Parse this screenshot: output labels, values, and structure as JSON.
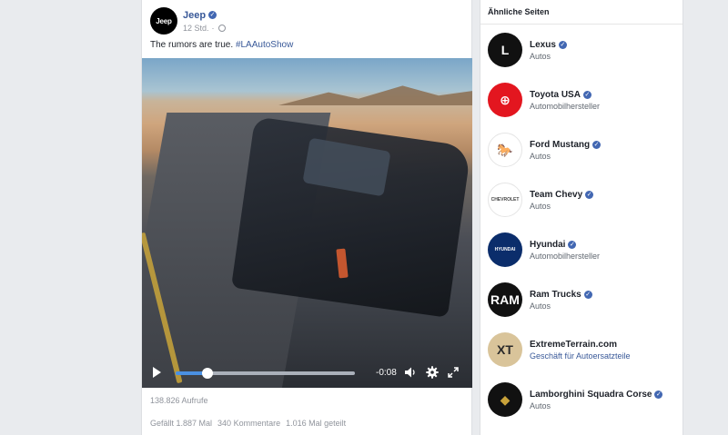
{
  "post": {
    "page_name": "Jeep",
    "avatar_text": "Jeep",
    "verified_mark": "✓",
    "time": "12 Std.",
    "separator": "·",
    "text": "The rumors are true.",
    "hashtag": "#LAAutoShow",
    "video": {
      "time_remaining": "-0:08",
      "progress": 0.18
    },
    "views": "138.826 Aufrufe",
    "likes": "Gefällt 1.887 Mal",
    "comments": "340 Kommentare",
    "shares": "1.016 Mal geteilt"
  },
  "sidebar": {
    "title": "Ähnliche Seiten",
    "items": [
      {
        "name": "Lexus",
        "category": "Autos",
        "logo": "lexus-logo",
        "logo_text": "L",
        "logo_bg": "#111111",
        "logo_fg": "#ffffff",
        "category_link": false
      },
      {
        "name": "Toyota USA",
        "category": "Automobilhersteller",
        "logo": "toyota-logo",
        "logo_text": "⊕",
        "logo_bg": "#e3161f",
        "logo_fg": "#ffffff",
        "category_link": false
      },
      {
        "name": "Ford Mustang",
        "category": "Autos",
        "logo": "mustang-logo",
        "logo_text": "🐎",
        "logo_bg": "#ffffff",
        "logo_fg": "#555555",
        "category_link": false
      },
      {
        "name": "Team Chevy",
        "category": "Autos",
        "logo": "chevy-logo",
        "logo_text": "CHEVROLET",
        "logo_bg": "#ffffff",
        "logo_fg": "#444444",
        "category_link": false
      },
      {
        "name": "Hyundai",
        "category": "Automobilhersteller",
        "logo": "hyundai-logo",
        "logo_text": "HYUNDAI",
        "logo_bg": "#0b2d6b",
        "logo_fg": "#ffffff",
        "category_link": false
      },
      {
        "name": "Ram Trucks",
        "category": "Autos",
        "logo": "ram-logo",
        "logo_text": "RAM",
        "logo_bg": "#111111",
        "logo_fg": "#ffffff",
        "category_link": false
      },
      {
        "name": "ExtremeTerrain.com",
        "category": "Geschäft für Autoersatzteile",
        "logo": "xt-logo",
        "logo_text": "XT",
        "logo_bg": "#d9c49a",
        "logo_fg": "#2a2a2a",
        "category_link": true
      },
      {
        "name": "Lamborghini Squadra Corse",
        "category": "Autos",
        "logo": "lamborghini-logo",
        "logo_text": "◆",
        "logo_bg": "#111111",
        "logo_fg": "#c9a23a",
        "category_link": false
      }
    ]
  },
  "colors": {
    "link": "#385898",
    "verified": "#4267b2",
    "progress": "#4a90e2",
    "background": "#e9ebee"
  },
  "icons": [
    "play-icon",
    "volume-icon",
    "gear-icon",
    "fullscreen-icon",
    "globe-icon",
    "verified-icon"
  ]
}
